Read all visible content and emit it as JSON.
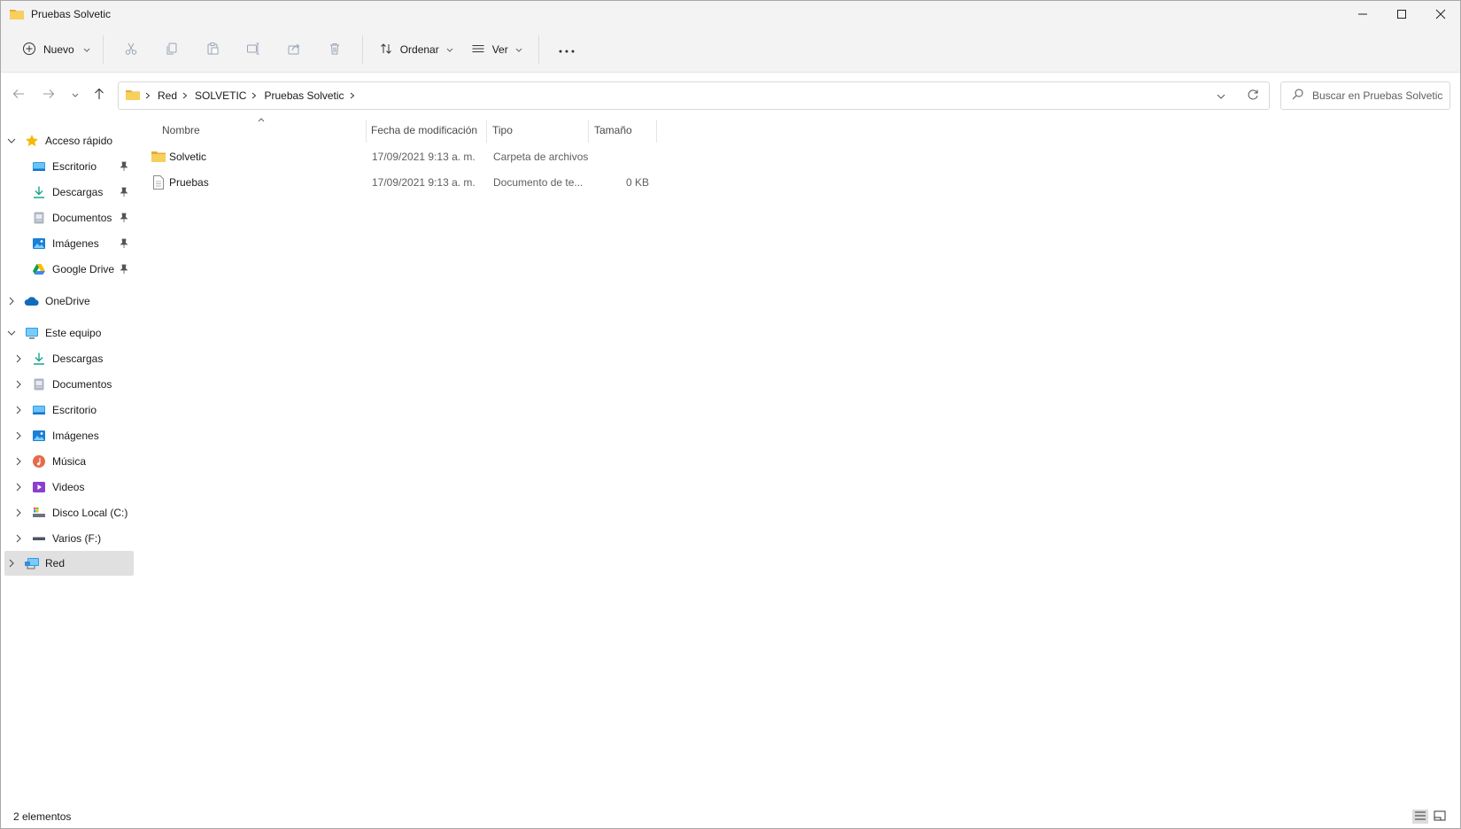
{
  "window": {
    "title": "Pruebas Solvetic"
  },
  "toolbar": {
    "new_label": "Nuevo",
    "sort_label": "Ordenar",
    "view_label": "Ver"
  },
  "address": {
    "crumbs": [
      "Red",
      "SOLVETIC",
      "Pruebas Solvetic"
    ],
    "search_placeholder": "Buscar en Pruebas Solvetic"
  },
  "sidebar": {
    "quick_access": {
      "label": "Acceso rápido",
      "items": [
        {
          "label": "Escritorio",
          "icon": "desktop-icon"
        },
        {
          "label": "Descargas",
          "icon": "download-icon"
        },
        {
          "label": "Documentos",
          "icon": "documents-icon"
        },
        {
          "label": "Imágenes",
          "icon": "pictures-icon"
        },
        {
          "label": "Google Drive",
          "icon": "google-drive-icon"
        }
      ]
    },
    "onedrive": {
      "label": "OneDrive"
    },
    "this_pc": {
      "label": "Este equipo",
      "items": [
        {
          "label": "Descargas",
          "icon": "download-icon"
        },
        {
          "label": "Documentos",
          "icon": "documents-icon"
        },
        {
          "label": "Escritorio",
          "icon": "desktop-icon"
        },
        {
          "label": "Imágenes",
          "icon": "pictures-icon"
        },
        {
          "label": "Música",
          "icon": "music-icon"
        },
        {
          "label": "Videos",
          "icon": "videos-icon"
        },
        {
          "label": "Disco Local (C:)",
          "icon": "drive-icon"
        },
        {
          "label": "Varios (F:)",
          "icon": "usb-drive-icon"
        }
      ]
    },
    "network": {
      "label": "Red"
    }
  },
  "list": {
    "columns": {
      "name": "Nombre",
      "modified": "Fecha de modificación",
      "type": "Tipo",
      "size": "Tamaño"
    },
    "rows": [
      {
        "name": "Solvetic",
        "modified": "17/09/2021 9:13 a. m.",
        "type": "Carpeta de archivos",
        "size": "",
        "icon": "folder-icon"
      },
      {
        "name": "Pruebas",
        "modified": "17/09/2021 9:13 a. m.",
        "type": "Documento de te...",
        "size": "0 KB",
        "icon": "text-file-icon"
      }
    ]
  },
  "status": {
    "count": "2 elementos"
  },
  "colors": {
    "accent": "#0067c0",
    "folder": "#f2c14e",
    "chrome": "#f3f3f3",
    "selection": "#e0e0e0"
  }
}
